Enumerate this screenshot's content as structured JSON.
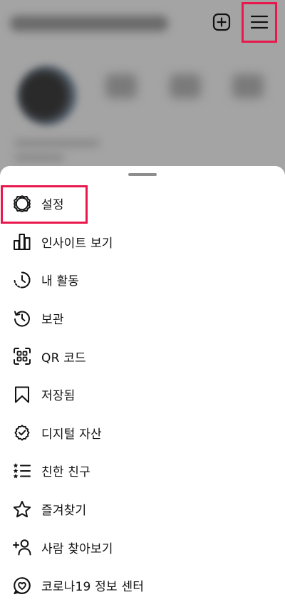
{
  "header": {
    "new_post_icon": "plus-square-icon",
    "menu_icon": "hamburger-menu-icon"
  },
  "highlight_color": "#e8184c",
  "menu": {
    "items": [
      {
        "label": "설정",
        "icon": "settings-gear-icon"
      },
      {
        "label": "인사이트 보기",
        "icon": "bar-chart-icon"
      },
      {
        "label": "내 활동",
        "icon": "activity-clock-icon"
      },
      {
        "label": "보관",
        "icon": "archive-history-icon"
      },
      {
        "label": "QR 코드",
        "icon": "qr-code-icon"
      },
      {
        "label": "저장됨",
        "icon": "bookmark-icon"
      },
      {
        "label": "디지털 자산",
        "icon": "digital-collectibles-shield-icon"
      },
      {
        "label": "친한 친구",
        "icon": "close-friends-list-icon"
      },
      {
        "label": "즐겨찾기",
        "icon": "star-icon"
      },
      {
        "label": "사람 찾아보기",
        "icon": "add-person-icon"
      },
      {
        "label": "코로나19 정보 센터",
        "icon": "covid-info-heart-icon"
      }
    ]
  }
}
